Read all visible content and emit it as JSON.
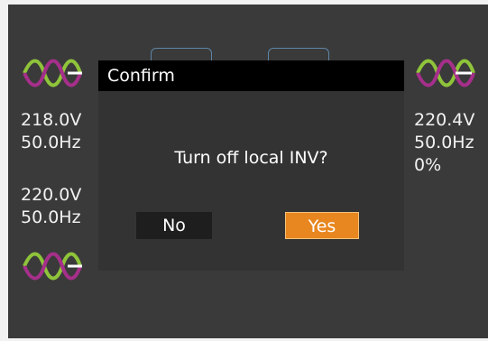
{
  "left_panel": {
    "input_voltage": "218.0V",
    "input_frequency": "50.0Hz",
    "output_voltage": "220.0V",
    "output_frequency": "50.0Hz"
  },
  "right_panel": {
    "voltage": "220.4V",
    "frequency": "50.0Hz",
    "load": "0%"
  },
  "icons": {
    "sine_wave": "sine-wave-icon"
  },
  "colors": {
    "screen_bg": "#3a3a3a",
    "dialog_bg": "#333333",
    "titlebar_bg": "#000000",
    "yes_button": "#e8861f",
    "no_button": "#1e1e1e",
    "wave_green": "#8fc43a",
    "wave_purple": "#a52f8a"
  },
  "dialog": {
    "title": "Confirm",
    "message": "Turn off local INV?",
    "no_label": "No",
    "yes_label": "Yes"
  }
}
